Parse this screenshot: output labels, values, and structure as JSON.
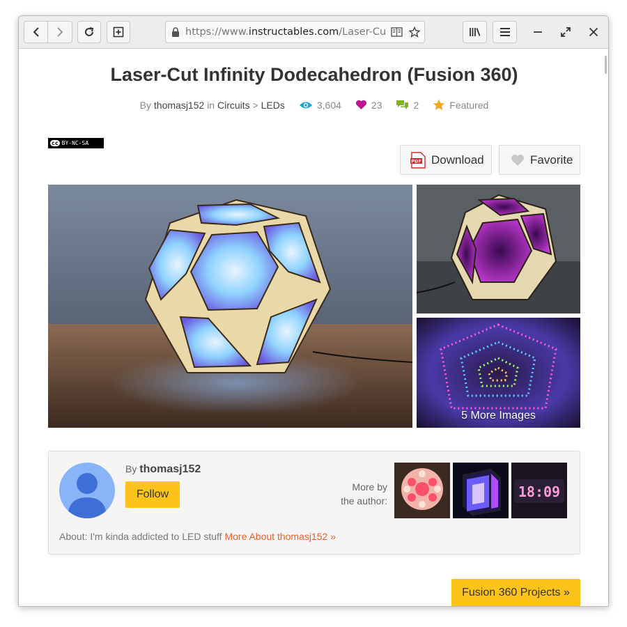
{
  "browser": {
    "url_prefix": "https://www.",
    "url_domain": "instructables.com",
    "url_path": "/Laser-Cut"
  },
  "article": {
    "title": "Laser-Cut Infinity Dodecahedron (Fusion 360)",
    "by_label": "By",
    "author": "thomasj152",
    "in_label": "in",
    "category": "Circuits",
    "separator": ">",
    "subcategory": "LEDs",
    "views": "3,604",
    "favorites": "23",
    "comments": "2",
    "featured": "Featured",
    "license_text": "BY-NC-SA",
    "license_cc": "cc"
  },
  "actions": {
    "download": "Download",
    "favorite": "Favorite",
    "pdf_label": "PDF"
  },
  "gallery": {
    "more_images": "5 More Images"
  },
  "author_box": {
    "by_label": "By",
    "author": "thomasj152",
    "follow": "Follow",
    "more_by_line1": "More by",
    "more_by_line2": "the author:",
    "about_prefix": "About: I'm kinda addicted to LED stuff",
    "more_about": "More About thomasj152 »",
    "clock_digits": "18:09"
  },
  "footer": {
    "category_button": "Fusion 360 Projects »"
  },
  "colors": {
    "accent_yellow": "#fcc31a",
    "link_orange": "#e5622a",
    "views_blue": "#1aa3d9",
    "favorites_magenta": "#c0148c",
    "comments_green": "#7cb321",
    "featured_orange": "#f5a623"
  },
  "icons": {
    "back": "chevron-left-icon",
    "forward": "chevron-right-icon",
    "reload": "reload-icon",
    "new_tab": "new-tab-icon",
    "lock": "lock-icon",
    "reader": "reader-view-icon",
    "bookmark": "star-icon",
    "library": "library-icon",
    "menu": "hamburger-menu-icon",
    "minimize": "minimize-icon",
    "maximize": "maximize-icon",
    "close": "close-icon"
  }
}
